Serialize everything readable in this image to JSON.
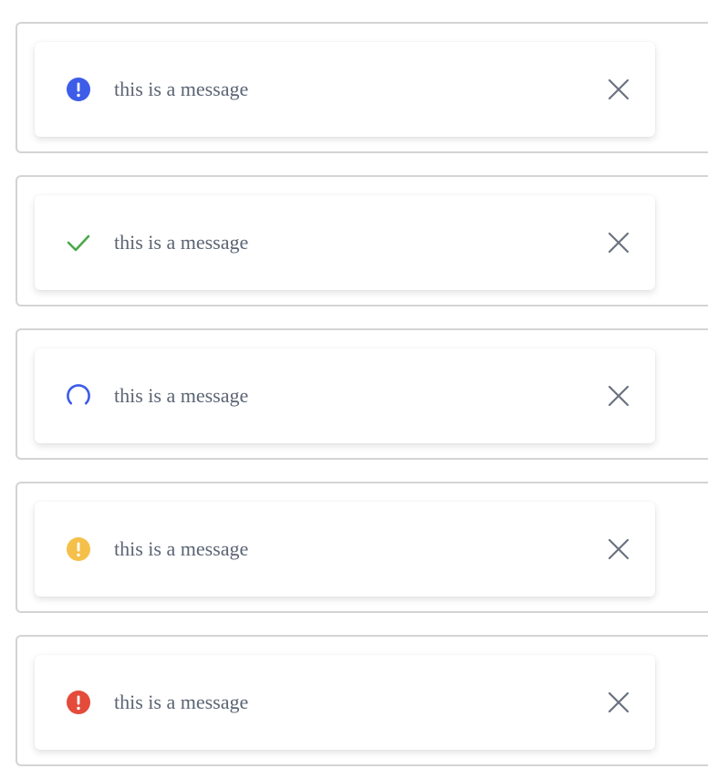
{
  "colors": {
    "info": "#3d5ce8",
    "success": "#4aa84a",
    "loading": "#3d5ce8",
    "warning": "#f5c04a",
    "error": "#e44b3a",
    "text": "#5b6474",
    "close": "#6b7280"
  },
  "toasts": [
    {
      "type": "info",
      "icon": "info-icon",
      "message": "this is a message",
      "close_icon": "close-icon"
    },
    {
      "type": "success",
      "icon": "check-icon",
      "message": "this is a message",
      "close_icon": "close-icon"
    },
    {
      "type": "loading",
      "icon": "spinner-icon",
      "message": "this is a message",
      "close_icon": "close-icon"
    },
    {
      "type": "warning",
      "icon": "warning-icon",
      "message": "this is a message",
      "close_icon": "close-icon"
    },
    {
      "type": "error",
      "icon": "error-icon",
      "message": "this is a message",
      "close_icon": "close-icon"
    }
  ]
}
